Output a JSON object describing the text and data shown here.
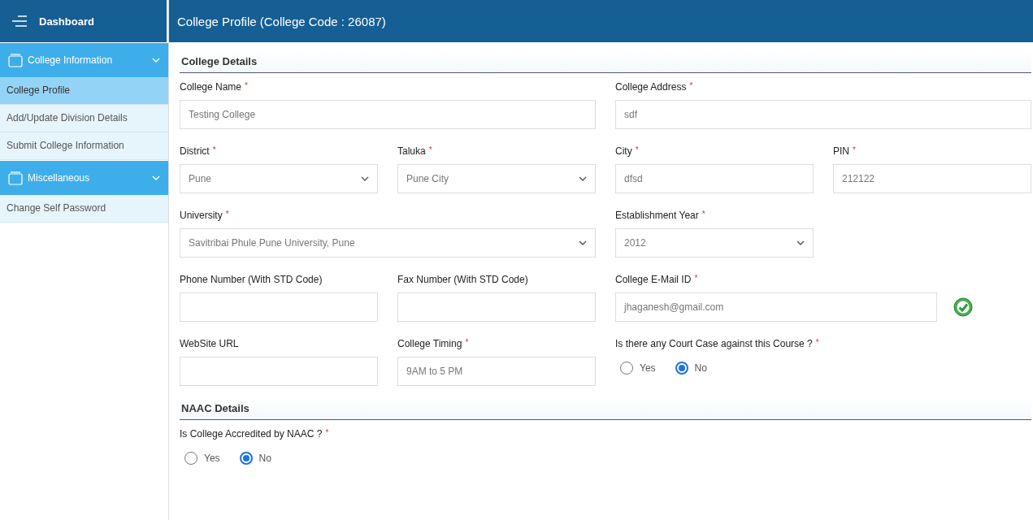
{
  "sidebar": {
    "title": "Dashboard",
    "groups": [
      {
        "label": "College Information",
        "expanded": true,
        "children": [
          {
            "label": "College Profile",
            "selected": true
          },
          {
            "label": "Add/Update Division Details",
            "selected": false
          },
          {
            "label": "Submit College Information",
            "selected": false
          }
        ]
      },
      {
        "label": "Miscellaneous",
        "expanded": true,
        "children": [
          {
            "label": "Change Self Password",
            "selected": false
          }
        ]
      }
    ]
  },
  "page_title": "College Profile (College Code : 26087)",
  "sections": [
    {
      "title": "College Details",
      "rows": [
        [
          {
            "label": "College Name",
            "required": "*",
            "kind": "text",
            "value": "Testing College"
          },
          {
            "label": "College Address",
            "required": "*",
            "kind": "text",
            "value": "sdf"
          }
        ],
        [
          {
            "label": "District",
            "required": "*",
            "kind": "select",
            "value": "Pune"
          },
          {
            "label": "Taluka",
            "required": "*",
            "kind": "select",
            "value": "Pune City"
          },
          {
            "label": "City",
            "required": "*",
            "kind": "text",
            "value": "dfsd"
          },
          {
            "label": "PIN",
            "required": "*",
            "kind": "text",
            "value": "212122"
          }
        ],
        [
          {
            "label": "University",
            "required": "*",
            "kind": "select",
            "value": "Savitribai Phule Pune University, Pune"
          },
          {
            "label": "Establishment Year",
            "required": "*",
            "kind": "select",
            "value": "2012"
          }
        ],
        [
          {
            "label": "Phone Number (With STD Code)",
            "kind": "text"
          },
          {
            "label": "Fax Number (With STD Code)",
            "kind": "text"
          },
          {
            "label": "College E-Mail ID",
            "required": "*",
            "kind": "text",
            "value": "jhaganesh@gmail.com",
            "verified": true
          }
        ],
        [
          {
            "label": "WebSite URL",
            "kind": "text"
          },
          {
            "label": "College Timing",
            "required": "*",
            "kind": "text",
            "value": "9AM  to 5 PM"
          },
          {
            "label": "Is there any Court Case against this Course ?",
            "required": "*",
            "kind": "radio",
            "options": [
              {
                "label": "Yes",
                "selected": false
              },
              {
                "label": "No",
                "selected": true
              }
            ]
          }
        ]
      ]
    },
    {
      "title": "NAAC Details",
      "rows": [
        [
          {
            "label": "Is College Accredited by NAAC ?",
            "required": "*",
            "kind": "radio",
            "options": [
              {
                "label": "Yes",
                "selected": false
              },
              {
                "label": "No",
                "selected": true
              }
            ]
          }
        ]
      ]
    }
  ]
}
